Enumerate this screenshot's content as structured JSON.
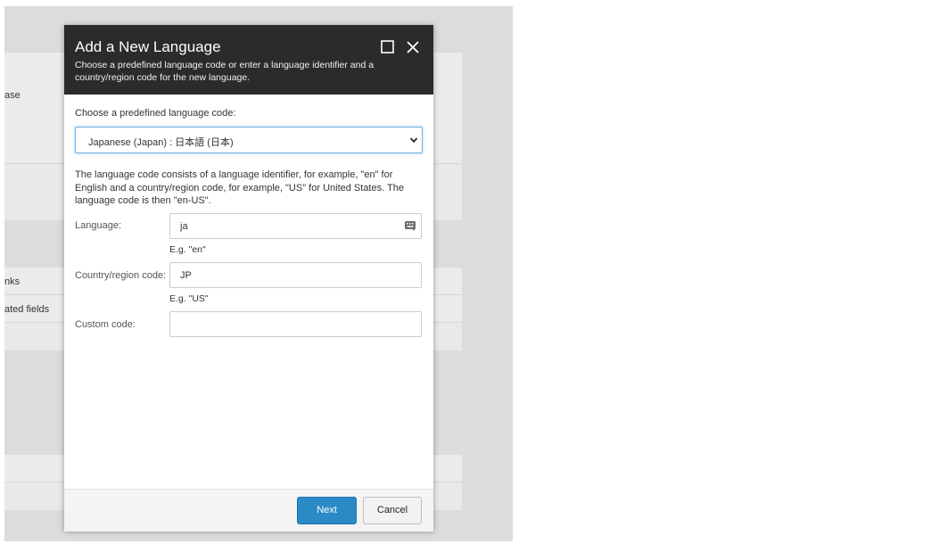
{
  "background": {
    "row_labels": [
      "ase",
      "nks",
      "ated fields"
    ]
  },
  "dialog": {
    "title": "Add a New Language",
    "subtitle": "Choose a predefined language code or enter a language identifier and a country/region code for the new language.",
    "predefined_label": "Choose a predefined language code:",
    "predefined_select": {
      "selected": "Japanese (Japan) : 日本語 (日本)"
    },
    "description": "The language code consists of a language identifier, for example, \"en\" for English and a country/region code, for example, \"US\" for United States. The language code is then \"en-US\".",
    "language": {
      "label": "Language:",
      "value": "ja",
      "hint": "E.g. \"en\""
    },
    "country": {
      "label": "Country/region code:",
      "value": "JP",
      "hint": "E.g. \"US\""
    },
    "custom": {
      "label": "Custom code:",
      "value": ""
    },
    "buttons": {
      "next": "Next",
      "cancel": "Cancel"
    },
    "header_icons": [
      "maximize-icon",
      "close-icon"
    ]
  },
  "colors": {
    "header_bg": "#2b2b2b",
    "primary_button": "#2a8ac6",
    "backdrop": "#dcdcdc"
  }
}
